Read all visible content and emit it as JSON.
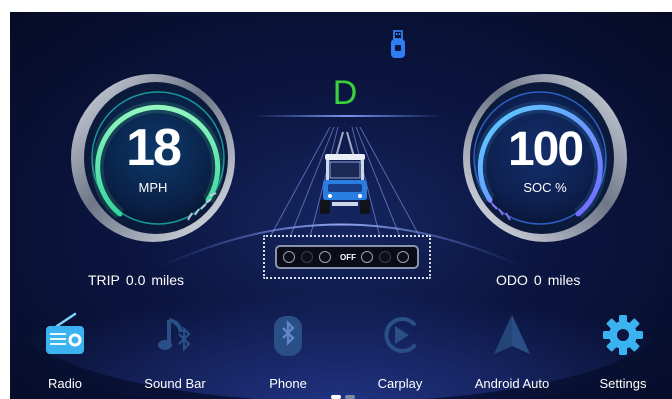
{
  "status": {
    "usb_icon": "usb-drive-icon",
    "usb_color": "#3a86ff"
  },
  "drive": {
    "gear": "D",
    "gear_color": "#3ad13a"
  },
  "speed": {
    "value": "18",
    "unit": "MPH",
    "accent": "#5ef0a0"
  },
  "battery": {
    "value": "100",
    "unit": "SOC %",
    "accent": "#4fb5ff"
  },
  "trip": {
    "label": "TRIP",
    "value": "0.0",
    "unit": "miles"
  },
  "odo": {
    "label": "ODO",
    "value": "0",
    "unit": "miles"
  },
  "indicators": {
    "off_label": "OFF"
  },
  "dock": {
    "items": [
      {
        "label": "Radio",
        "icon": "radio-icon"
      },
      {
        "label": "Sound Bar",
        "icon": "music-bluetooth-icon"
      },
      {
        "label": "Phone",
        "icon": "bluetooth-phone-icon"
      },
      {
        "label": "Carplay",
        "icon": "carplay-icon"
      },
      {
        "label": "Android Auto",
        "icon": "android-auto-icon"
      },
      {
        "label": "Settings",
        "icon": "settings-gear-icon"
      }
    ]
  },
  "colors": {
    "background": "#0b1540",
    "text": "#ffffff"
  }
}
